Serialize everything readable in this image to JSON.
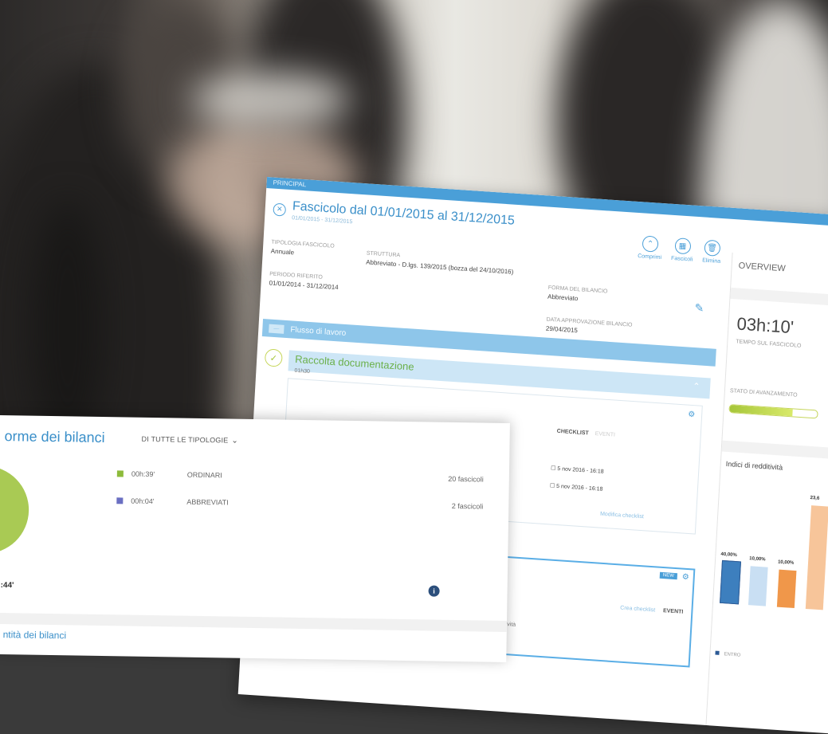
{
  "back_panel": {
    "topbar_text": "PRINCIPAL",
    "title": "Fascicolo dal 01/01/2015 al 31/12/2015",
    "subtitle": "01/01/2015 - 31/12/2015",
    "close_icon": "close-circle-icon",
    "tools": [
      {
        "icon": "chevron-up-icon",
        "label": "Comprimi"
      },
      {
        "icon": "grid-icon",
        "label": "Fascicoli"
      },
      {
        "icon": "trash-icon",
        "label": "Elimina"
      }
    ],
    "tipologia_label": "TIPOLOGIA FASCICOLO",
    "tipologia_value": "Annuale",
    "struttura_label": "STRUTTURA",
    "struttura_value": "Abbreviato - D.lgs. 139/2015 (bozza del 24/10/2016)",
    "periodo_label": "PERIODO RIFERITO",
    "periodo_value": "01/01/2014 - 31/12/2014",
    "forma_label": "FORMA DEL BILANCIO",
    "forma_value": "Abbreviato",
    "data_label": "DATA APPROVAZIONE BILANCIO",
    "data_value": "29/04/2015",
    "flow_tag": "—",
    "flow_label": "Flusso di lavoro",
    "step_name": "Raccolta documentazione",
    "step_sub": "01h30",
    "checklist_tab": "CHECKLIST",
    "eventi_tab": "EVENTI",
    "dates": [
      "5 nov 2016 - 16:18",
      "5 nov 2016 - 16:18"
    ],
    "modify_link": "Modifica checklist",
    "badge": "NEW",
    "card2_link": "Crea checklist",
    "card2_eventi": "EVENTI",
    "card2_extra": "Attività"
  },
  "overview": {
    "title": "OVERVIEW",
    "time": "03h:10'",
    "time_label": "TEMPO SUL FASCICOLO",
    "stato_label": "STATO DI AVANZAMENTO",
    "progress": 0.72,
    "redditivita_label": "Indici di redditività",
    "bars": [
      {
        "label": "40,00%",
        "value": 40,
        "color": "#3d7fbe"
      },
      {
        "label": "10,00%",
        "value": 38,
        "color": "#c9dff3"
      },
      {
        "label": "10,00%",
        "value": 36,
        "color": "#f0974a"
      },
      {
        "label": "23,6",
        "value": 100,
        "color": "#f7c59a"
      }
    ],
    "legend_label": "ENTRO"
  },
  "front_panel": {
    "title": "orme dei bilanci",
    "dropdown_label": "DI TUTTE LE TIPOLOGIE",
    "rows": [
      {
        "time": "00h:39'",
        "name": "ORDINARI",
        "count": "20 fascicoli",
        "color": "#8dbb3b"
      },
      {
        "time": "00h:04'",
        "name": "ABBREVIATI",
        "count": "2 fascicoli",
        "color": "#6a6fc2"
      }
    ],
    "total": ":44'",
    "info_glyph": "i",
    "bottom_label": "ntità dei bilanci",
    "pie_color": "#a9ca54"
  }
}
